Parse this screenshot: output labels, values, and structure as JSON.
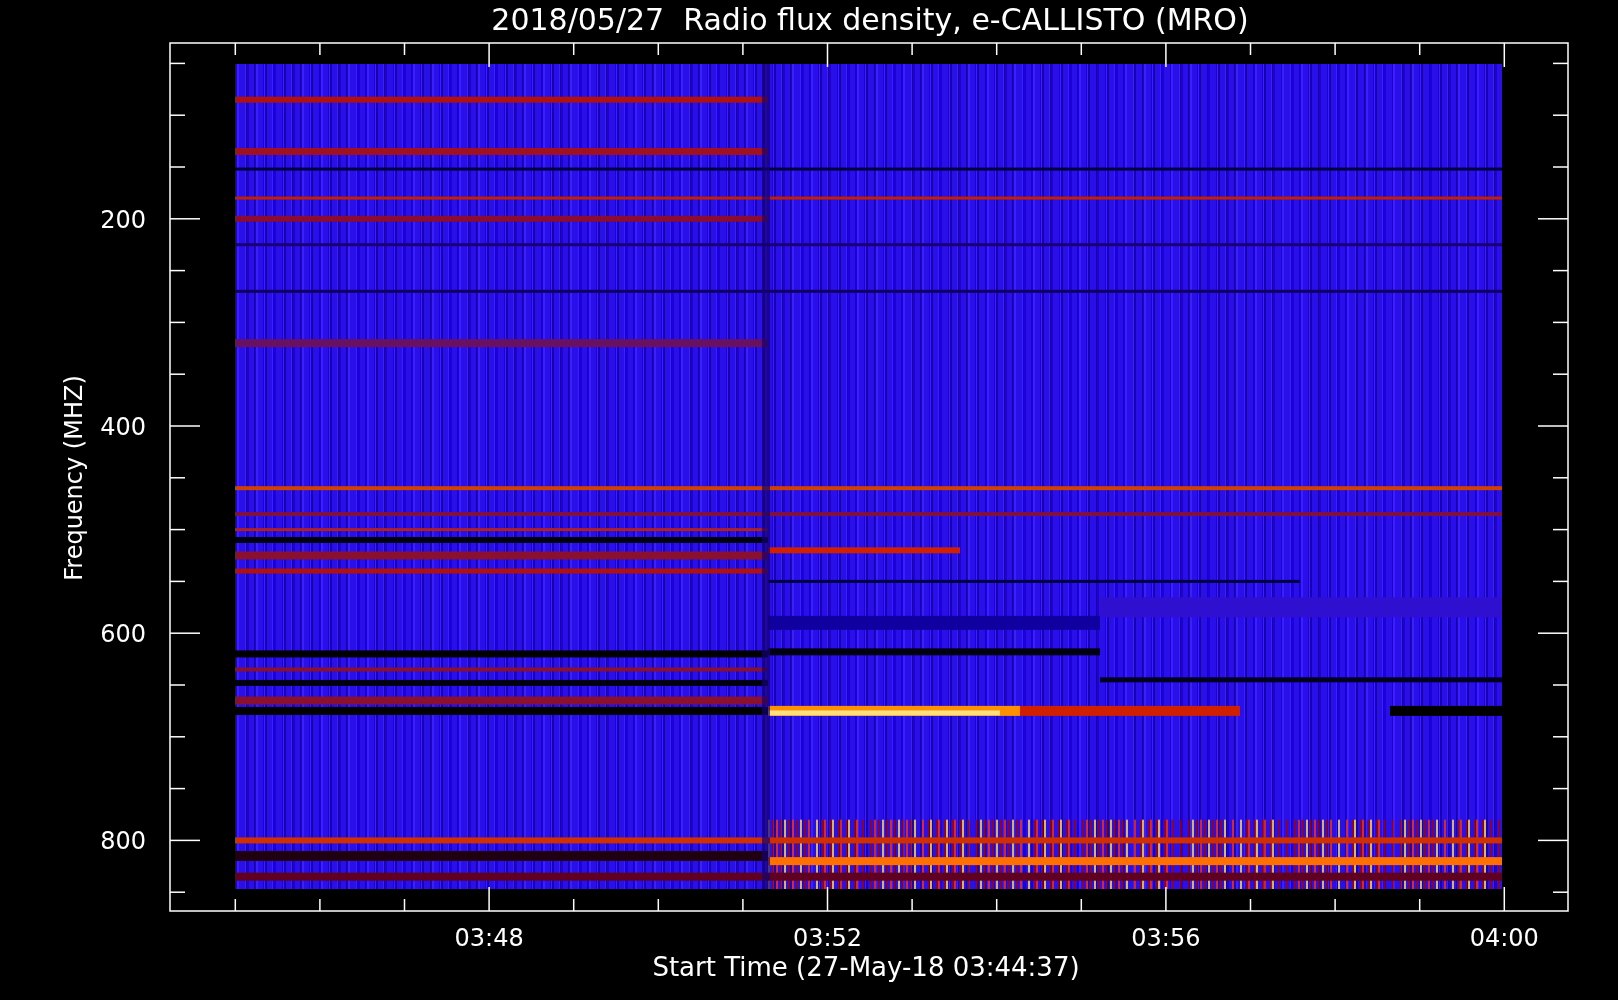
{
  "chart": {
    "title": "2018/05/27  Radio flux density, e-CALLISTO (MRO)",
    "xlabel": "Start Time (27-May-18 03:44:37)",
    "ylabel": "Frequency (MHZ)",
    "xticks": [
      "03:48",
      "03:52",
      "03:56",
      "04:00"
    ],
    "yticks": [
      "200",
      "400",
      "600",
      "800"
    ]
  }
}
